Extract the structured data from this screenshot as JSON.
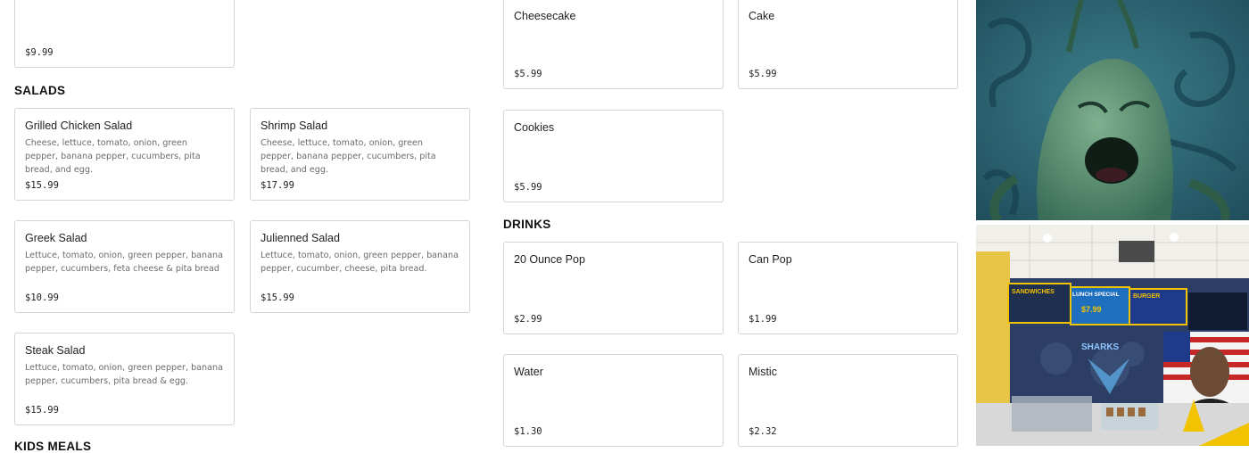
{
  "top_left_card": {
    "price": "$9.99"
  },
  "sections": {
    "salads": "SALADS",
    "drinks": "DRINKS",
    "kids_meals": "KIDS MEALS"
  },
  "salads": [
    {
      "name": "Grilled Chicken Salad",
      "desc": "Cheese, lettuce, tomato, onion, green pepper, banana pepper, cucumbers, pita bread, and egg.",
      "price": "$15.99"
    },
    {
      "name": "Shrimp Salad",
      "desc": "Cheese, lettuce, tomato, onion, green pepper, banana pepper, cucumbers, pita bread, and egg.",
      "price": "$17.99"
    },
    {
      "name": "Greek Salad",
      "desc": "Lettuce, tomato, onion, green pepper, banana pepper, cucumbers, feta cheese & pita bread",
      "price": "$10.99"
    },
    {
      "name": "Julienned Salad",
      "desc": "Lettuce, tomato, onion, green pepper, banana pepper, cucumber, cheese, pita bread.",
      "price": "$15.99"
    },
    {
      "name": "Steak Salad",
      "desc": "Lettuce, tomato, onion, green pepper, banana pepper, cucumbers, pita bread & egg.",
      "price": "$15.99"
    }
  ],
  "desserts": [
    {
      "name": "Cheesecake",
      "price": "$5.99"
    },
    {
      "name": "Cake",
      "price": "$5.99"
    },
    {
      "name": "Cookies",
      "price": "$5.99"
    }
  ],
  "drinks": [
    {
      "name": "20 Ounce Pop",
      "price": "$2.99"
    },
    {
      "name": "Can Pop",
      "price": "$1.99"
    },
    {
      "name": "Water",
      "price": "$1.30"
    },
    {
      "name": "Mistic",
      "price": "$2.32"
    }
  ],
  "restaurant_photo": {
    "signs": [
      "SANDWICHES",
      "LUNCH SPECIAL",
      "BURGER"
    ],
    "price_sign": "$7.99",
    "logo": "SHARKS"
  }
}
